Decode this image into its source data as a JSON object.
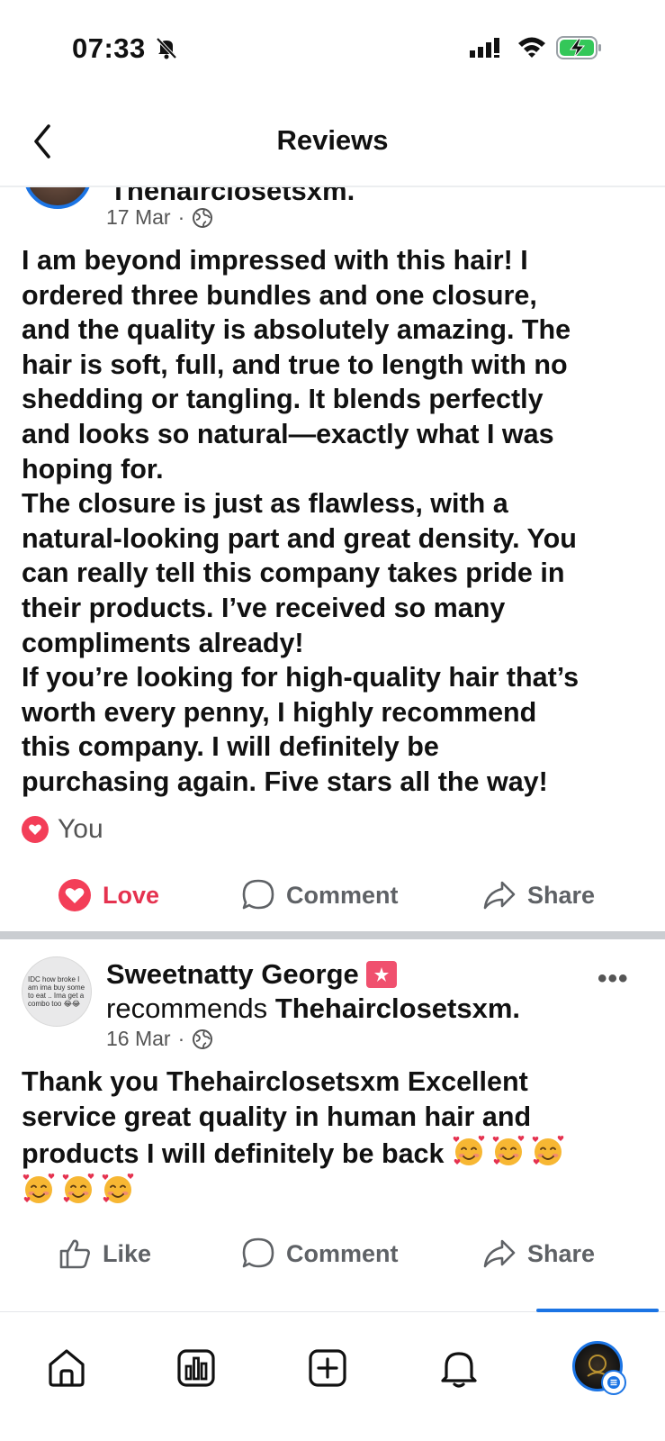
{
  "status_bar": {
    "time": "07:33",
    "icons": [
      "bell-slash-icon",
      "cellular-signal-icon",
      "wifi-icon",
      "battery-charging-icon"
    ]
  },
  "header": {
    "title": "Reviews",
    "back_icon": "chevron-left-icon"
  },
  "posts": [
    {
      "author_partial": "Thehairclosetsxm.",
      "date": "17 Mar",
      "separator": "·",
      "privacy_icon": "globe-icon",
      "text": "I am beyond impressed with this hair! I\nordered three bundles and one closure,\nand the quality is absolutely amazing. The\nhair is soft, full, and true to length with no\nshedding or tangling. It blends perfectly\nand looks so natural—exactly what I was\nhoping for.\nThe closure is just as flawless, with a\nnatural-looking part and great density. You\ncan really tell this company takes pride in\ntheir products. I’ve received so many\ncompliments already!\nIf you’re looking for high-quality hair that’s\nworth every penny, I highly recommend\nthis company. I will definitely be\npurchasing again. Five stars all the way!",
      "reaction_by": "You",
      "reaction_icon": "heart-icon",
      "actions": [
        {
          "label": "Love",
          "icon": "heart-icon",
          "active": true
        },
        {
          "label": "Comment",
          "icon": "comment-icon"
        },
        {
          "label": "Share",
          "icon": "share-icon"
        }
      ]
    },
    {
      "author": "Sweetnatty George",
      "author_badge_icon": "recommend-badge-icon",
      "recommend_text": "recommends",
      "page_name": "Thehairclosetsxm.",
      "avatar_caption": "IDC how broke I am ima buy some to eat .. Ima get a combo too 😂😂",
      "date": "16 Mar",
      "separator": "·",
      "privacy_icon": "globe-icon",
      "more_label": "•••",
      "text": "Thank you Thehairclosetsxm Excellent\nservice great quality in human hair and\nproducts I will definitely be back",
      "emoji_icon": "smiling-face-with-hearts-icon",
      "emoji_count": 6,
      "actions": [
        {
          "label": "Like",
          "icon": "thumbs-up-icon"
        },
        {
          "label": "Comment",
          "icon": "comment-icon"
        },
        {
          "label": "Share",
          "icon": "share-icon"
        }
      ]
    }
  ],
  "bottom_nav": {
    "items": [
      "home-icon",
      "dashboard-icon",
      "create-icon",
      "notifications-icon",
      "profile-icon"
    ],
    "active": "profile-icon"
  },
  "colors": {
    "accent_blue": "#1b74e4",
    "love_red": "#e5324f",
    "text": "#111111",
    "muted": "#5f6266"
  }
}
